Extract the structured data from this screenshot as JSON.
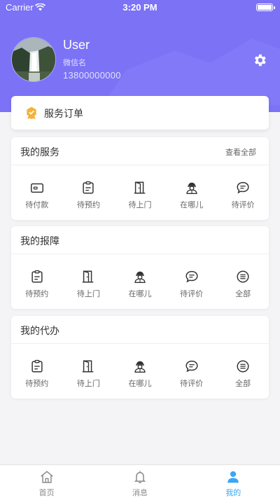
{
  "status_bar": {
    "carrier": "Carrier",
    "time": "3:20 PM"
  },
  "profile": {
    "username": "User",
    "nickname": "微信名",
    "phone": "13800000000"
  },
  "order_card": {
    "label": "服务订单"
  },
  "my_services": {
    "title": "我的服务",
    "more": "查看全部",
    "items": [
      {
        "label": "待付款",
        "icon": "wallet-icon"
      },
      {
        "label": "待预约",
        "icon": "clipboard-icon"
      },
      {
        "label": "待上门",
        "icon": "door-icon"
      },
      {
        "label": "在哪儿",
        "icon": "worker-icon"
      },
      {
        "label": "待评价",
        "icon": "chat-bubble-icon"
      }
    ]
  },
  "my_repairs": {
    "title": "我的报障",
    "items": [
      {
        "label": "待预约",
        "icon": "clipboard-icon"
      },
      {
        "label": "待上门",
        "icon": "door-icon"
      },
      {
        "label": "在哪儿",
        "icon": "worker-icon"
      },
      {
        "label": "待评价",
        "icon": "chat-bubble-icon"
      },
      {
        "label": "全部",
        "icon": "list-circle-icon"
      }
    ]
  },
  "my_agency": {
    "title": "我的代办",
    "items": [
      {
        "label": "待预约",
        "icon": "clipboard-icon"
      },
      {
        "label": "待上门",
        "icon": "door-icon"
      },
      {
        "label": "在哪儿",
        "icon": "worker-icon"
      },
      {
        "label": "待评价",
        "icon": "chat-bubble-icon"
      },
      {
        "label": "全部",
        "icon": "list-circle-icon"
      }
    ]
  },
  "tabbar": {
    "items": [
      {
        "label": "首页",
        "icon": "home-icon"
      },
      {
        "label": "消息",
        "icon": "bell-icon"
      },
      {
        "label": "我的",
        "icon": "user-icon"
      }
    ],
    "active_index": 2
  },
  "colors": {
    "header": "#7b72f6",
    "accent": "#3aa7f4",
    "badge": "#f3b23a"
  }
}
